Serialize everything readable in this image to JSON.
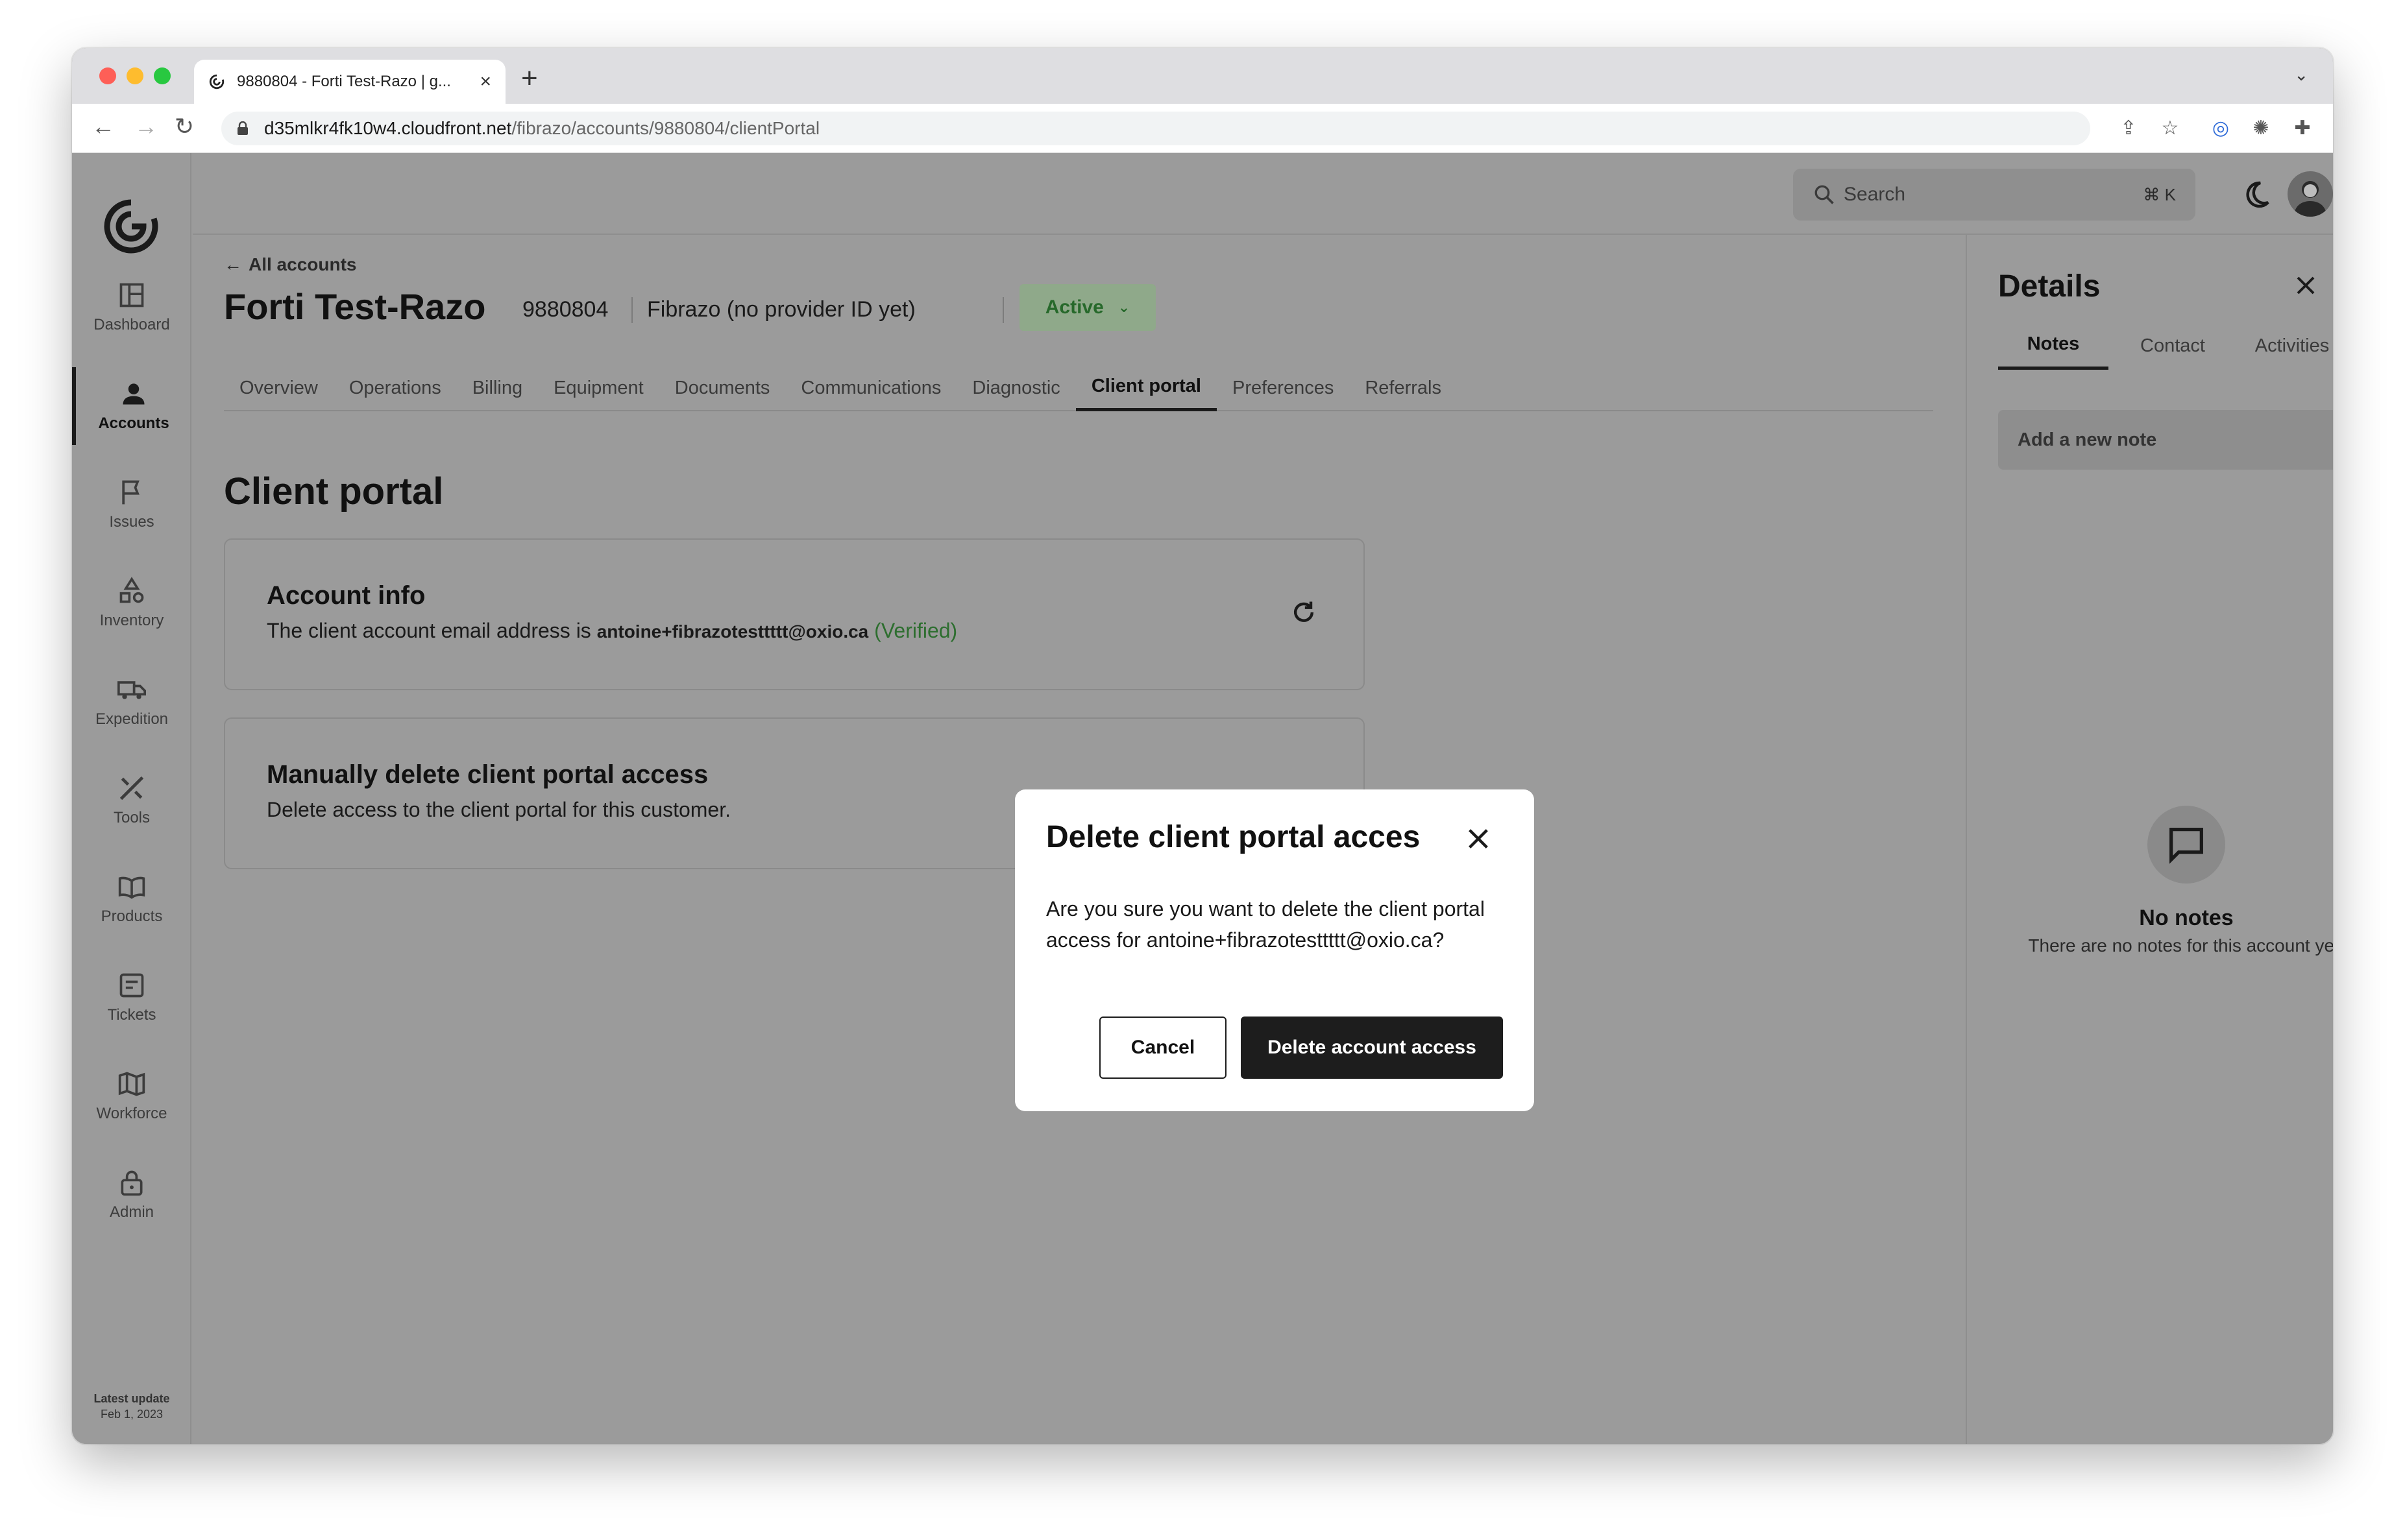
{
  "browser": {
    "tab_title": "9880804 - Forti Test-Razo | g...",
    "new_tab_symbol": "+",
    "url_host": "d35mlkr4fk10w4.cloudfront.net",
    "url_path": "/fibrazo/accounts/9880804/clientPortal"
  },
  "sidebar": {
    "items": [
      {
        "label": "Dashboard",
        "icon": "dashboard-icon"
      },
      {
        "label": "Accounts",
        "icon": "person-icon"
      },
      {
        "label": "Issues",
        "icon": "flag-icon"
      },
      {
        "label": "Inventory",
        "icon": "shapes-icon"
      },
      {
        "label": "Expedition",
        "icon": "truck-icon"
      },
      {
        "label": "Tools",
        "icon": "tools-icon"
      },
      {
        "label": "Products",
        "icon": "book-icon"
      },
      {
        "label": "Tickets",
        "icon": "ticket-icon"
      },
      {
        "label": "Workforce",
        "icon": "map-icon"
      },
      {
        "label": "Admin",
        "icon": "lock-icon"
      }
    ],
    "active": "Accounts",
    "latest_update_title": "Latest update",
    "latest_update_date": "Feb 1, 2023"
  },
  "header": {
    "search_placeholder": "Search",
    "search_shortcut": "⌘ K"
  },
  "account": {
    "back_label": "All accounts",
    "name": "Forti Test-Razo",
    "id": "9880804",
    "provider": "Fibrazo (no provider ID yet)",
    "status": "Active"
  },
  "tabs": [
    "Overview",
    "Operations",
    "Billing",
    "Equipment",
    "Documents",
    "Communications",
    "Diagnostic",
    "Client portal",
    "Preferences",
    "Referrals"
  ],
  "active_tab": "Client portal",
  "client_portal": {
    "title": "Client portal",
    "account_info_title": "Account info",
    "account_info_prefix": "The client account email address is",
    "email": "antoine+fibrazotesttttt@oxio.ca",
    "verified": "(Verified)",
    "delete_title": "Manually delete client portal access",
    "delete_text": "Delete access to the client portal for this customer."
  },
  "details": {
    "title": "Details",
    "tabs": [
      "Notes",
      "Contact",
      "Activities"
    ],
    "note_placeholder": "Add a new note",
    "empty_title": "No notes",
    "empty_text": "There are no notes for this account yet."
  },
  "modal": {
    "title": "Delete client portal acces",
    "body": "Are you sure you want to delete the client portal access for antoine+fibrazotesttttt@oxio.ca?",
    "cancel_label": "Cancel",
    "confirm_label": "Delete account access"
  },
  "colors": {
    "overlay": "#9b9b9b",
    "status_green": "#27692b",
    "primary_dark": "#1d1d1d"
  }
}
